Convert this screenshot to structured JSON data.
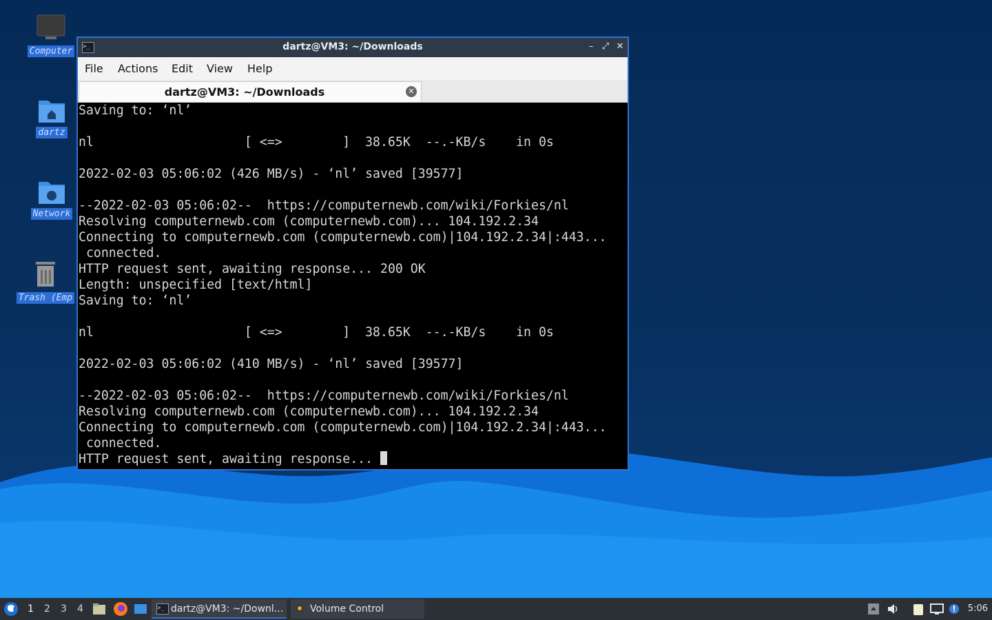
{
  "desktop": {
    "icons": [
      {
        "label": "Computer",
        "icon": "monitor-icon"
      },
      {
        "label": "dartz",
        "icon": "home-folder-icon"
      },
      {
        "label": "Network",
        "icon": "network-folder-icon"
      },
      {
        "label": "Trash (Emp",
        "icon": "trash-icon"
      }
    ]
  },
  "window": {
    "title": "dartz@VM3: ~/Downloads",
    "menu": [
      "File",
      "Actions",
      "Edit",
      "View",
      "Help"
    ],
    "tab_title": "dartz@VM3: ~/Downloads",
    "terminal_lines": [
      "Saving to: ‘nl’",
      "",
      "nl                    [ <=>        ]  38.65K  --.-KB/s    in 0s",
      "",
      "2022-02-03 05:06:02 (426 MB/s) - ‘nl’ saved [39577]",
      "",
      "--2022-02-03 05:06:02--  https://computernewb.com/wiki/Forkies/nl",
      "Resolving computernewb.com (computernewb.com)... 104.192.2.34",
      "Connecting to computernewb.com (computernewb.com)|104.192.2.34|:443...",
      " connected.",
      "HTTP request sent, awaiting response... 200 OK",
      "Length: unspecified [text/html]",
      "Saving to: ‘nl’",
      "",
      "nl                    [ <=>        ]  38.65K  --.-KB/s    in 0s",
      "",
      "2022-02-03 05:06:02 (410 MB/s) - ‘nl’ saved [39577]",
      "",
      "--2022-02-03 05:06:02--  https://computernewb.com/wiki/Forkies/nl",
      "Resolving computernewb.com (computernewb.com)... 104.192.2.34",
      "Connecting to computernewb.com (computernewb.com)|104.192.2.34|:443...",
      " connected.",
      "HTTP request sent, awaiting response... "
    ]
  },
  "taskbar": {
    "workspaces": [
      "1",
      "2",
      "3",
      "4"
    ],
    "tasks": [
      {
        "label": "dartz@VM3: ~/Downl..."
      },
      {
        "label": "Volume Control"
      }
    ],
    "clock": "5:06"
  },
  "colors": {
    "accent": "#2f74d0",
    "titlebar": "#2f3a48",
    "terminal_bg": "#000000",
    "terminal_fg": "#d8d8d8"
  }
}
